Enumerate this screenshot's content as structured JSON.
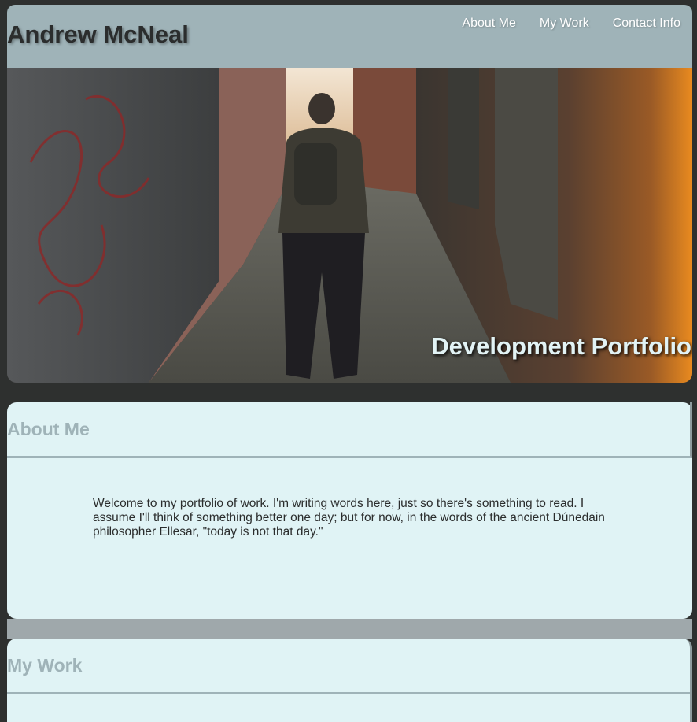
{
  "header": {
    "site_title": "Andrew McNeal",
    "nav": [
      {
        "label": "About Me"
      },
      {
        "label": "My Work"
      },
      {
        "label": "Contact Info"
      }
    ]
  },
  "hero": {
    "caption": "Development Portfolio"
  },
  "about": {
    "heading": "About Me",
    "text": "Welcome to my portfolio of work. I'm writing words here, just so there's something to read. I assume I'll think of something better one day; but for now, in the words of the ancient Dúnedain philosopher Ellesar, \"today is not that day.\""
  },
  "work": {
    "heading": "My Work"
  },
  "colors": {
    "page_bg": "#2e302f",
    "header_bg": "#9fb3b8",
    "card_bg": "#e0f3f5",
    "heading_color": "#9fb3b8",
    "text_color": "#2b2d2d"
  }
}
